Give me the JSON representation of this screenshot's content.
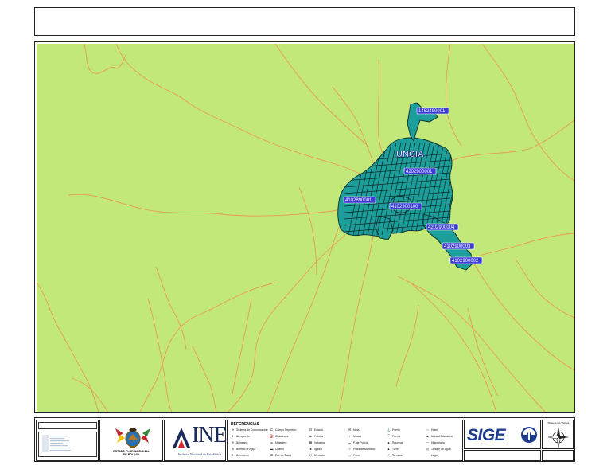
{
  "map": {
    "colors": {
      "land": "#c3e87a",
      "road": "#e89a55",
      "urban": "#1c9e9a",
      "urban_line": "#0b2a2a",
      "label_bg": "#3b3bd9"
    },
    "urban_label": "UNCIA",
    "zone_labels": [
      "1452490001",
      "4202900001",
      "4102890001",
      "4102900100",
      "4202900004",
      "4102900003",
      "4102900002"
    ]
  },
  "footer": {
    "state": {
      "name": "ESTADO PLURINACIONAL\nDE BOLIVIA"
    },
    "ine": {
      "logo_text": "INE",
      "subtitle": "Instituto Nacional de Estadística"
    },
    "references": {
      "title": "REFERENCIAS",
      "items": [
        {
          "icon": "antenna-icon",
          "glyph": "⛯",
          "label": "Sistema de Comunicación"
        },
        {
          "icon": "airport-icon",
          "glyph": "✈",
          "label": "Aeropuerto"
        },
        {
          "icon": "bath-icon",
          "glyph": "≋",
          "label": "Balneario"
        },
        {
          "icon": "water-pump-icon",
          "glyph": "⊛",
          "label": "Bomba de Agua"
        },
        {
          "icon": "cemetery-icon",
          "glyph": "♱",
          "label": "Cemeterio"
        },
        {
          "icon": "sports-field-icon",
          "glyph": "⊏",
          "label": "Campo Deportivo"
        },
        {
          "icon": "gas-station-icon",
          "glyph": "⛽",
          "label": "Gasolinera"
        },
        {
          "icon": "slaughterhouse-icon",
          "glyph": "⌓",
          "label": "Matadero"
        },
        {
          "icon": "barracks-icon",
          "glyph": "▬",
          "label": "Cuartel"
        },
        {
          "icon": "health-center-icon",
          "glyph": "⊞",
          "label": "Est. de Salud"
        },
        {
          "icon": "stadium-icon",
          "glyph": "⊟",
          "label": "Estadio"
        },
        {
          "icon": "factory-icon",
          "glyph": "▰",
          "label": "Fábrica"
        },
        {
          "icon": "industry-icon",
          "glyph": "▦",
          "label": "Industria"
        },
        {
          "icon": "church-icon",
          "glyph": "♜",
          "label": "Iglesia"
        },
        {
          "icon": "market-icon",
          "glyph": "✕",
          "label": "Mercado"
        },
        {
          "icon": "mine-icon",
          "glyph": "⚒",
          "label": "Mina"
        },
        {
          "icon": "museum-icon",
          "glyph": "♁",
          "label": "Museo"
        },
        {
          "icon": "police-icon",
          "glyph": "⌴",
          "label": "P. de Policía"
        },
        {
          "icon": "plaza-icon",
          "glyph": "⊹",
          "label": "Plaza de Mercado"
        },
        {
          "icon": "well-icon",
          "glyph": "◡",
          "label": "Pozo"
        },
        {
          "icon": "port-icon",
          "glyph": "⚓",
          "label": "Puerto"
        },
        {
          "icon": "bridge-icon",
          "glyph": "⏜",
          "label": "Puente"
        },
        {
          "icon": "reservoir-icon",
          "glyph": "▲",
          "label": "Represa"
        },
        {
          "icon": "tower-icon",
          "glyph": "▲",
          "label": "Torre"
        },
        {
          "icon": "terminal-icon",
          "glyph": "↗",
          "label": "Terminal"
        },
        {
          "icon": "hotel-icon",
          "glyph": "⌂",
          "label": "Hotel"
        },
        {
          "icon": "school-icon",
          "glyph": "▲",
          "label": "Unidad Educativa"
        },
        {
          "icon": "river-icon",
          "glyph": "∼",
          "label": "Hidrografía"
        },
        {
          "icon": "water-tank-icon",
          "glyph": "◎",
          "label": "Tanque de Agua"
        },
        {
          "icon": "lake-icon",
          "glyph": "◌",
          "label": "Lago"
        }
      ]
    },
    "sigec": {
      "logo_text": "SIGE"
    },
    "compass": {
      "label": "Rosa de los Vientos"
    }
  }
}
